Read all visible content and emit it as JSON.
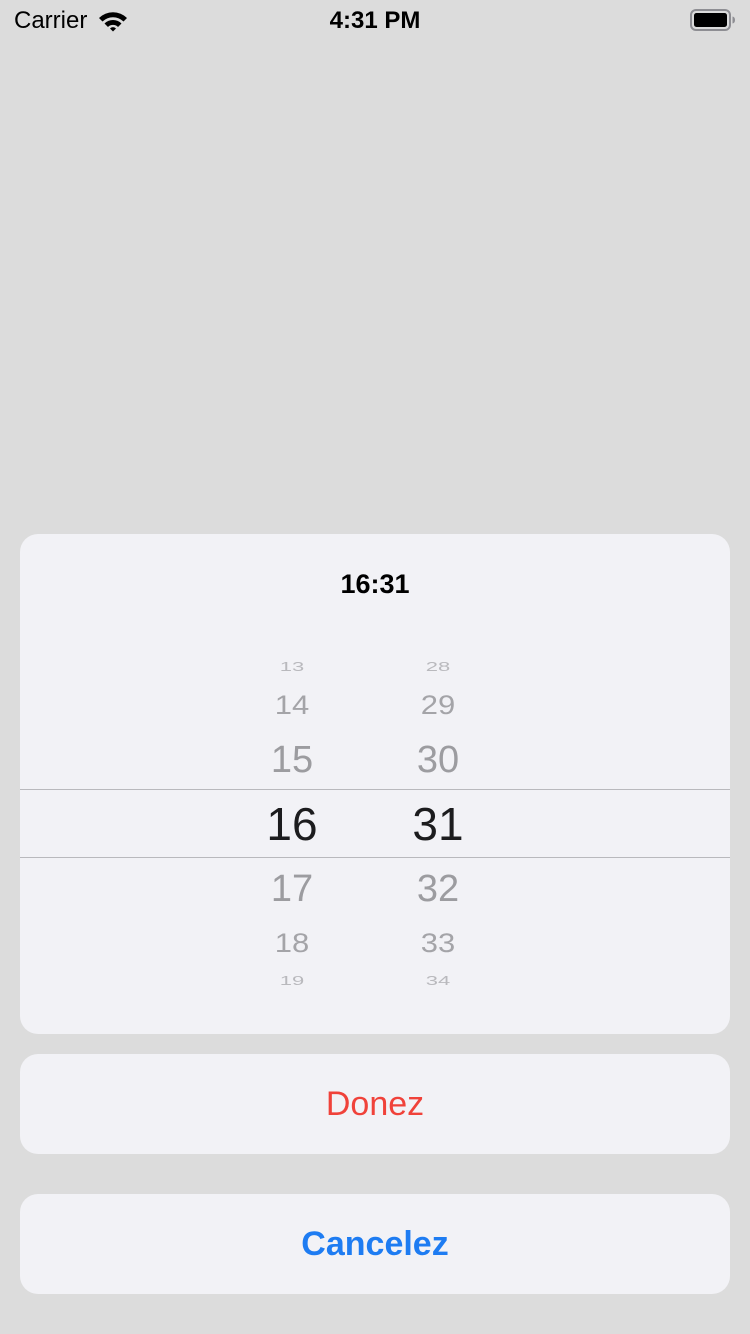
{
  "status_bar": {
    "carrier": "Carrier",
    "time": "4:31 PM",
    "wifi_icon": "wifi-icon",
    "battery_icon": "battery-icon"
  },
  "picker": {
    "title": "16:31",
    "hours": {
      "above": [
        "13",
        "14",
        "15"
      ],
      "selected": "16",
      "below": [
        "17",
        "18",
        "19"
      ]
    },
    "minutes": {
      "above": [
        "28",
        "29",
        "30"
      ],
      "selected": "31",
      "below": [
        "32",
        "33",
        "34"
      ]
    }
  },
  "actions": {
    "done_label": "Donez",
    "cancel_label": "Cancelez"
  },
  "colors": {
    "background": "#dcdcdc",
    "sheet": "#f2f2f6",
    "done": "#f0423a",
    "cancel": "#1e7cf2"
  }
}
